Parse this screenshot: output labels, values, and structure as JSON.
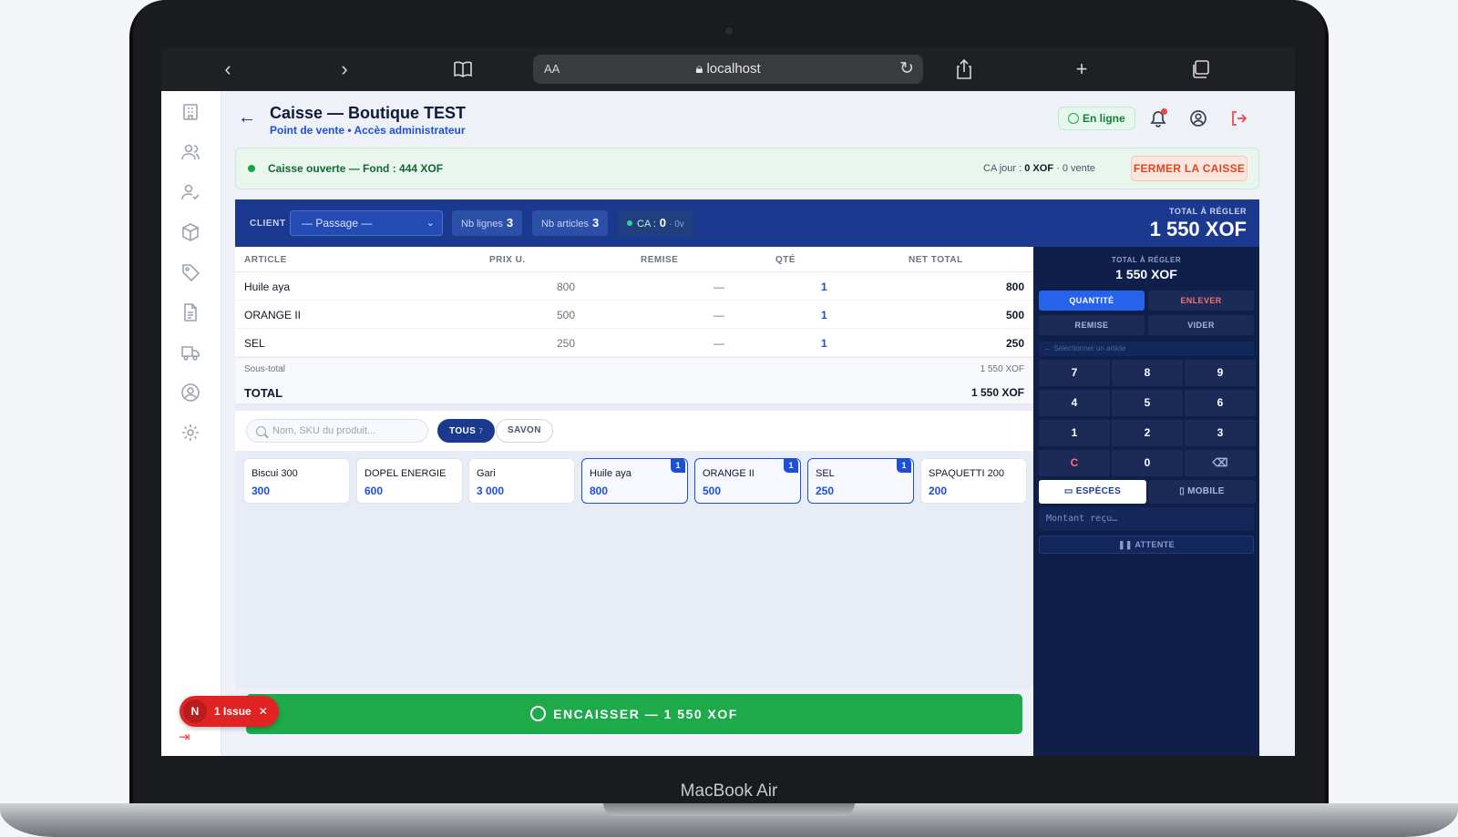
{
  "device": {
    "label": "MacBook Air"
  },
  "browser": {
    "aa": "AA",
    "url": "localhost"
  },
  "header": {
    "title": "Caisse — Boutique TEST",
    "subtitle": "Point de vente • Accès administrateur",
    "status": "En ligne"
  },
  "status_bar": {
    "text": "Caisse ouverte — Fond : 444 XOF",
    "ca_prefix": "CA jour :",
    "ca_value": "0 XOF",
    "ca_suffix": "· 0 vente",
    "close_label": "FERMER LA CAISSE"
  },
  "client_bar": {
    "client_label": "CLIENT",
    "client_value": "— Passage —",
    "nb_lignes_label": "Nb lignes",
    "nb_lignes": "3",
    "nb_articles_label": "Nb articles",
    "nb_articles": "3",
    "ca_label": "CA :",
    "ca_value": "0",
    "ca_suffix": "· 0v",
    "total_label": "TOTAL À RÉGLER",
    "total_value": "1 550 XOF"
  },
  "table": {
    "columns": [
      "ARTICLE",
      "PRIX U.",
      "REMISE",
      "QTÉ",
      "NET TOTAL"
    ],
    "rows": [
      {
        "article": "Huile aya",
        "price": "800",
        "discount": "—",
        "qty": "1",
        "net": "800"
      },
      {
        "article": "ORANGE II",
        "price": "500",
        "discount": "—",
        "qty": "1",
        "net": "500"
      },
      {
        "article": "SEL",
        "price": "250",
        "discount": "—",
        "qty": "1",
        "net": "250"
      }
    ],
    "subtotal_label": "Sous-total",
    "subtotal_value": "1 550 XOF",
    "total_label": "TOTAL",
    "total_value": "1 550 XOF"
  },
  "search": {
    "placeholder": "Nom, SKU du produit..."
  },
  "filters": [
    {
      "label": "TOUS",
      "count": "7"
    },
    {
      "label": "SAVON"
    }
  ],
  "products": [
    {
      "name": "Biscui 300",
      "price": "300"
    },
    {
      "name": "DOPEL ENERGIE",
      "price": "600"
    },
    {
      "name": "Gari",
      "price": "3 000"
    },
    {
      "name": "Huile aya",
      "price": "800",
      "badge": "1"
    },
    {
      "name": "ORANGE II",
      "price": "500",
      "badge": "1"
    },
    {
      "name": "SEL",
      "price": "250",
      "badge": "1"
    },
    {
      "name": "SPAQUETTI 200",
      "price": "200"
    }
  ],
  "pay_button": {
    "label": "ENCAISSER — 1 550 XOF"
  },
  "issue": {
    "letter": "N",
    "label": "1 Issue",
    "close": "✕"
  },
  "numpad": {
    "total_label": "TOTAL À RÉGLER",
    "total_value": "1 550 XOF",
    "quantite": "QUANTITÉ",
    "enlever": "ENLEVER",
    "remise": "REMISE",
    "vider": "VIDER",
    "hint": "← Sélectionner un article",
    "keys": [
      "7",
      "8",
      "9",
      "4",
      "5",
      "6",
      "1",
      "2",
      "3",
      "C",
      "0",
      "⌫"
    ],
    "especes": "ESPÈCES",
    "mobile": "MOBILE",
    "amount_placeholder": "Montant reçu…",
    "attente": "ATTENTE"
  },
  "colors": {
    "brand": "#1b3a8f",
    "accent": "#1d4fd8",
    "success": "#1eaa4b",
    "danger": "#e02424"
  }
}
